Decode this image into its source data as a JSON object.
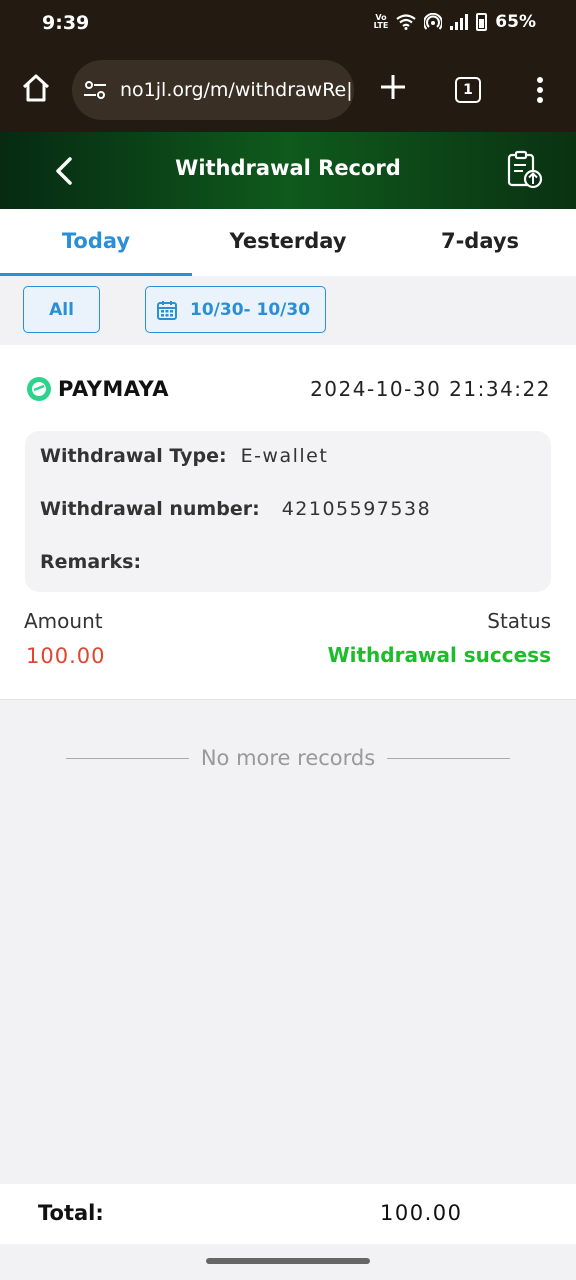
{
  "status_bar": {
    "time": "9:39",
    "volte": "VoLTE",
    "battery": "65%"
  },
  "browser": {
    "url": "no1jl.org/m/withdrawRe|",
    "tab_count": "1"
  },
  "header": {
    "title": "Withdrawal Record"
  },
  "tabs": [
    {
      "label": "Today",
      "active": true
    },
    {
      "label": "Yesterday",
      "active": false
    },
    {
      "label": "7-days",
      "active": false
    }
  ],
  "filters": {
    "all_label": "All",
    "date_range": "10/30- 10/30"
  },
  "record": {
    "method": "PAYMAYA",
    "datetime": "2024-10-30 21:34:22",
    "type_label": "Withdrawal Type:",
    "type_value": "E-wallet",
    "number_label": "Withdrawal number:",
    "number_value": "42105597538",
    "remarks_label": "Remarks:",
    "remarks_value": "",
    "amount_label": "Amount",
    "amount_value": "100.00",
    "status_label": "Status",
    "status_value": "Withdrawal success"
  },
  "no_more": "No more records",
  "footer": {
    "total_label": "Total:",
    "total_value": "100.00"
  },
  "colors": {
    "accent": "#2a8fd6",
    "success": "#1cbc2b",
    "amount": "#e0452f",
    "header_green": "#0f5a1c"
  }
}
